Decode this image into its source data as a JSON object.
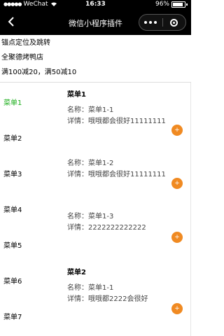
{
  "status_bar": {
    "carrier": "WeChat",
    "time": "16:33",
    "battery": "96%"
  },
  "navbar": {
    "title": "微信小程序插件"
  },
  "header": {
    "line1": "锚点定位及跳转",
    "line2": "全聚德烤鸭店",
    "line3": "满100减20，满50减10"
  },
  "sidebar": {
    "items": [
      {
        "label": "菜单1"
      },
      {
        "label": "菜单2"
      },
      {
        "label": "菜单3"
      },
      {
        "label": "菜单4"
      },
      {
        "label": "菜单5"
      },
      {
        "label": "菜单6"
      },
      {
        "label": "菜单7"
      }
    ]
  },
  "content": {
    "sections": [
      {
        "title": "菜单1",
        "items": [
          {
            "name": "名称：菜单1-1",
            "detail": "详情：哦哦都会很好11111111"
          },
          {
            "name": "名称：菜单1-2",
            "detail": "详情：哦哦都会很好11111111"
          },
          {
            "name": "名称：菜单1-3",
            "detail": "详情：2222222222222"
          }
        ]
      },
      {
        "title": "菜单2",
        "items": [
          {
            "name": "名称：菜单1-1",
            "detail": "详情：哦哦都2222会很好"
          }
        ]
      }
    ],
    "add_symbol": "+"
  },
  "colors": {
    "active": "#1aad19",
    "add_button": "#f08a22",
    "bars": "#000000"
  }
}
